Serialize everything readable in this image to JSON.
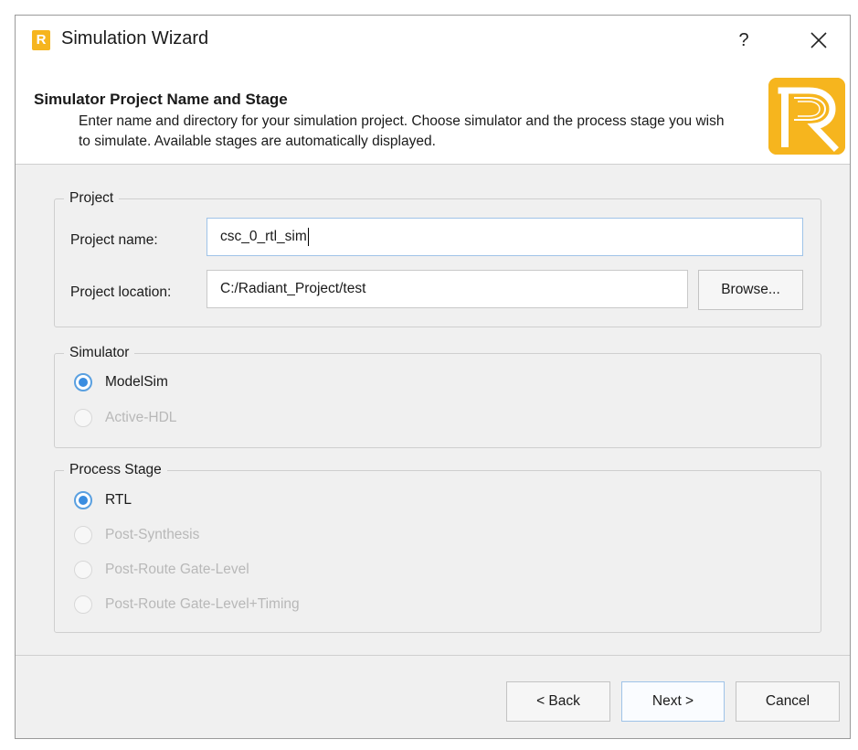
{
  "window": {
    "title": "Simulation Wizard",
    "app_icon_letter": "R",
    "help_label": "?",
    "close_icon": "close-icon"
  },
  "header": {
    "title": "Simulator Project Name and Stage",
    "description": "Enter name and directory for your simulation project. Choose simulator and the process stage you wish to simulate. Available stages are automatically displayed.",
    "logo_letter": "R"
  },
  "project": {
    "legend": "Project",
    "name_label": "Project name:",
    "name_value": "csc_0_rtl_sim",
    "location_label": "Project location:",
    "location_value": "C:/Radiant_Project/test",
    "browse_label": "Browse..."
  },
  "simulator": {
    "legend": "Simulator",
    "options": [
      {
        "label": "ModelSim",
        "checked": true,
        "enabled": true
      },
      {
        "label": "Active-HDL",
        "checked": false,
        "enabled": false
      }
    ]
  },
  "process_stage": {
    "legend": "Process Stage",
    "options": [
      {
        "label": "RTL",
        "checked": true,
        "enabled": true
      },
      {
        "label": "Post-Synthesis",
        "checked": false,
        "enabled": false
      },
      {
        "label": "Post-Route Gate-Level",
        "checked": false,
        "enabled": false
      },
      {
        "label": "Post-Route Gate-Level+Timing",
        "checked": false,
        "enabled": false
      }
    ]
  },
  "footer": {
    "back_label": "< Back",
    "next_label": "Next >",
    "cancel_label": "Cancel"
  },
  "colors": {
    "accent": "#3a8de0",
    "brand": "#f6b51e"
  }
}
